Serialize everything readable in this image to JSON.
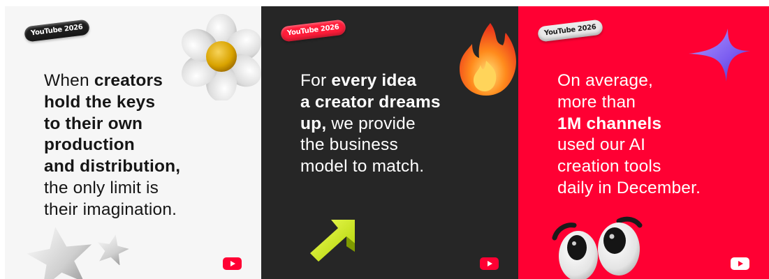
{
  "panels": [
    {
      "badge": "YouTube 2026",
      "lines": [
        [
          "When ",
          "creators"
        ],
        [
          "hold the keys",
          ""
        ],
        [
          "to their own",
          ""
        ],
        [
          "production",
          ""
        ],
        [
          "and distribution,",
          ""
        ],
        [
          "the only limit is",
          ""
        ],
        [
          "their imagination.",
          ""
        ]
      ],
      "text": {
        "l1_plain": "When ",
        "l1_bold": "creators",
        "l2_bold": "hold the keys",
        "l3_bold": "to their own",
        "l4_bold": "production",
        "l5_bold": "and distribution,",
        "l6_plain": "the only limit is",
        "l7_plain": "their imagination."
      },
      "background": "#f6f6f6",
      "decorations": [
        "flower-icon",
        "star-icon",
        "small-star-icon",
        "youtube-logo-icon"
      ]
    },
    {
      "badge": "YouTube 2026",
      "text": {
        "l1_plain": "For ",
        "l1_bold": "every idea",
        "l2_bold": "a creator dreams",
        "l3_bold": "up,",
        "l3_plain": " we provide",
        "l4_plain": "the business",
        "l5_plain": "model to match."
      },
      "background": "#262626",
      "decorations": [
        "fire-icon",
        "arrow-up-right-icon",
        "youtube-logo-icon"
      ]
    },
    {
      "badge": "YouTube 2026",
      "text": {
        "l1_plain": "On average,",
        "l2_plain": "more than",
        "l3_bold": "1M channels",
        "l4_plain": "used our AI",
        "l5_plain": "creation tools",
        "l6_plain": "daily in December."
      },
      "background": "#ff0033",
      "decorations": [
        "sparkle-icon",
        "eyes-icon",
        "youtube-logo-icon"
      ]
    }
  ],
  "colors": {
    "youtube_red": "#ff0033",
    "dark_panel": "#262626",
    "light_panel": "#f6f6f6"
  }
}
